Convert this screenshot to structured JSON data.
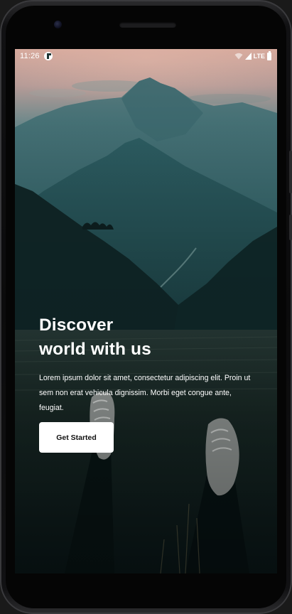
{
  "status_bar": {
    "time": "11:26",
    "network_label": "LTE",
    "icons": [
      "notification-app-icon",
      "wifi-icon",
      "cellular-signal-icon",
      "battery-icon"
    ]
  },
  "hero": {
    "title_line1": "Discover",
    "title_line2": "world with us",
    "description": "Lorem ipsum dolor sit amet, consectetur adipiscing elit. Proin ut sem non erat vehicula dignissim. Morbi eget congue ante, feugiat."
  },
  "cta": {
    "label": "Get Started"
  },
  "colors": {
    "sky_top": "#d7a79b",
    "mountain_far": "#3f6f75",
    "mountain_mid": "#1f4a4f",
    "foreground": "#0b1f20",
    "button_bg": "#ffffff",
    "text_primary": "#ffffff"
  }
}
